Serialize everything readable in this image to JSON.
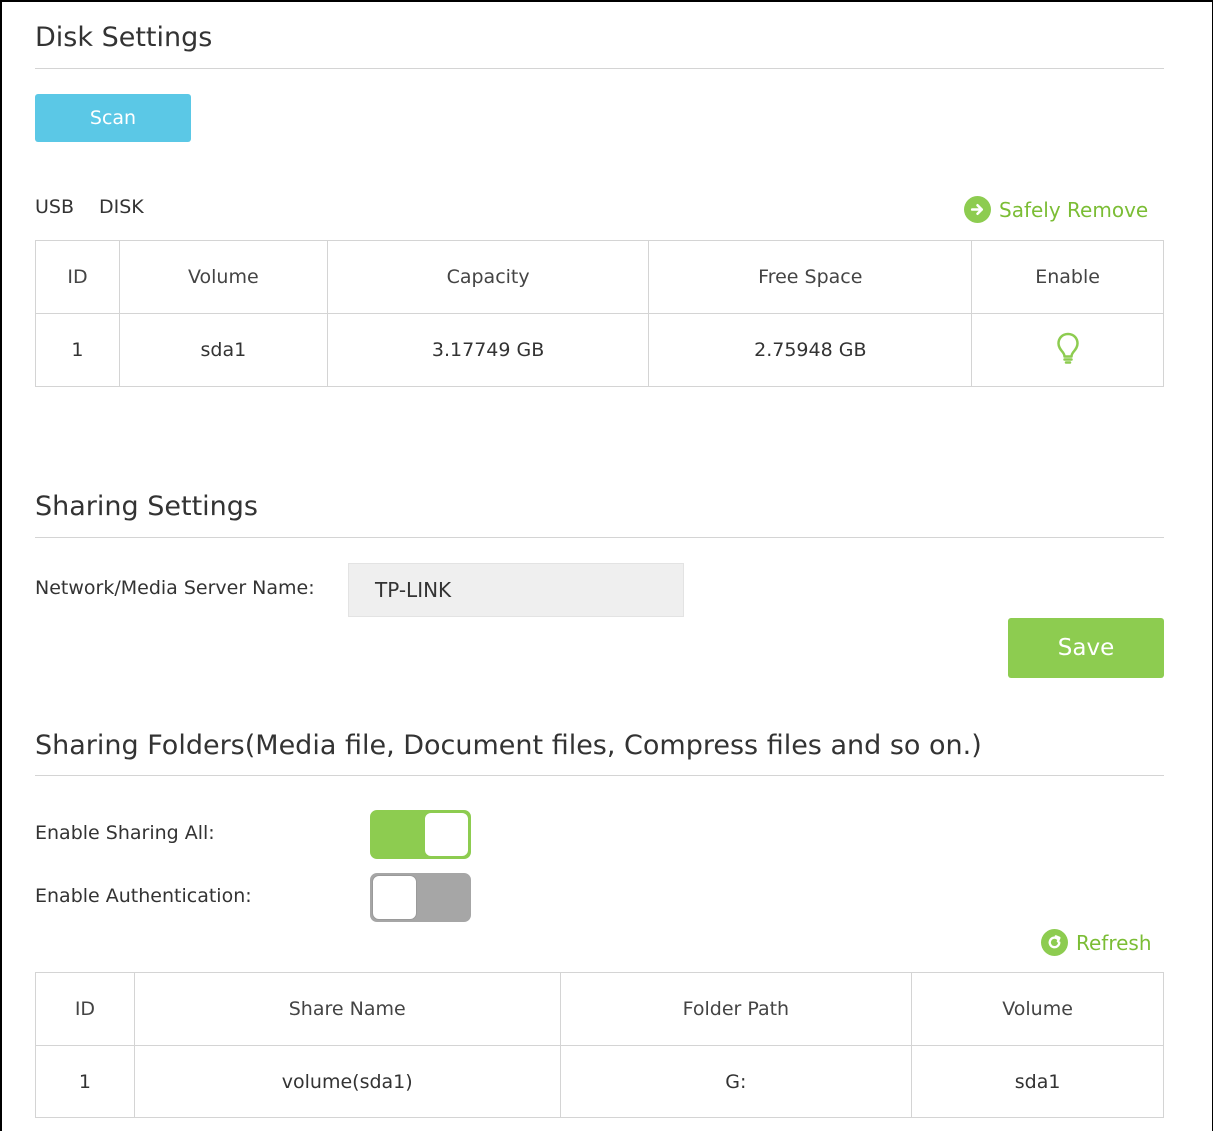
{
  "disk_settings": {
    "title": "Disk Settings",
    "scan_label": "Scan",
    "usb_label": "USB",
    "disk_label": "DISK",
    "safely_remove_label": "Safely Remove",
    "table": {
      "headers": [
        "ID",
        "Volume",
        "Capacity",
        "Free Space",
        "Enable"
      ],
      "rows": [
        {
          "id": "1",
          "volume": "sda1",
          "capacity": "3.17749 GB",
          "free_space": "2.75948 GB",
          "enable_icon": "lightbulb-icon"
        }
      ]
    }
  },
  "sharing_settings": {
    "title": "Sharing Settings",
    "server_name_label": "Network/Media Server Name:",
    "server_name_value": "TP-LINK",
    "save_label": "Save"
  },
  "sharing_folders": {
    "title": "Sharing Folders(Media file, Document files, Compress files and so on.)",
    "enable_sharing_all_label": "Enable Sharing All:",
    "enable_sharing_all": true,
    "enable_authentication_label": "Enable Authentication:",
    "enable_authentication": false,
    "refresh_label": "Refresh",
    "table": {
      "headers": [
        "ID",
        "Share Name",
        "Folder Path",
        "Volume"
      ],
      "rows": [
        {
          "id": "1",
          "share_name": "volume(sda1)",
          "folder_path": "G:",
          "volume": "sda1"
        }
      ]
    }
  },
  "colors": {
    "scan_button": "#5bc8e6",
    "accent_green": "#8dcc50",
    "toggle_off": "#a6a6a6"
  }
}
